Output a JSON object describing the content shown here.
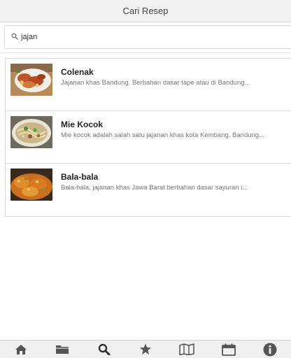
{
  "header": {
    "title": "Cari Resep"
  },
  "search": {
    "value": "jajan",
    "icon": "search-icon"
  },
  "results": [
    {
      "title": "Colenak",
      "desc": "Jajanan khas Bandung. Berbahan dasar tape atau di Bandung..."
    },
    {
      "title": "Mie Kocok",
      "desc": "Mie kocok adalah salah satu jajanan khas kota Kembang, Bandung..."
    },
    {
      "title": "Bala-bala",
      "desc": "Bala-bala, jajanan khas Jawa Barat berbahan dasar sayuran i..."
    }
  ],
  "tabbar": {
    "tabs": [
      {
        "icon": "home-icon"
      },
      {
        "icon": "folder-icon"
      },
      {
        "icon": "search-icon",
        "active": true
      },
      {
        "icon": "star-icon"
      },
      {
        "icon": "map-icon"
      },
      {
        "icon": "calendar-icon"
      },
      {
        "icon": "info-icon"
      }
    ]
  },
  "colors": {
    "header_bg": "#f2f2f2",
    "tab_icon": "#555555",
    "title": "#222222",
    "desc": "#777777"
  }
}
